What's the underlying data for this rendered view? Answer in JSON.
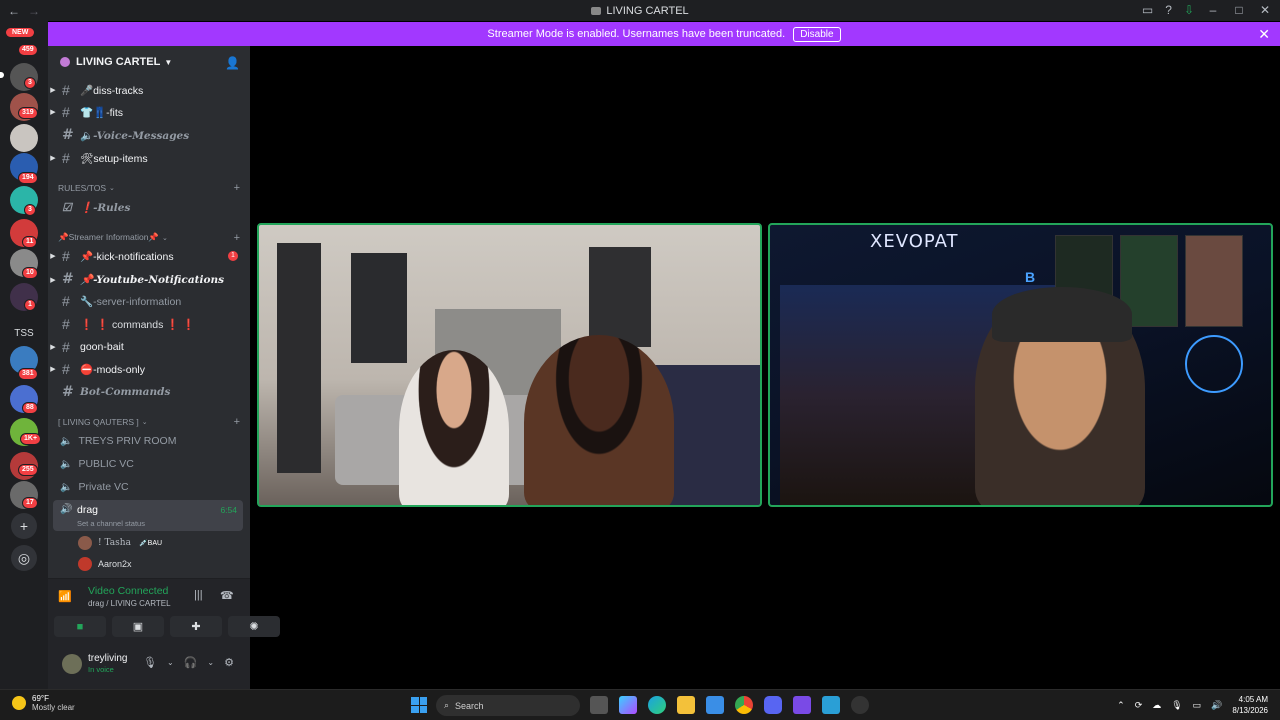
{
  "window": {
    "title": "LIVING CARTEL",
    "back": "←",
    "forward": "→"
  },
  "banner": {
    "text": "Streamer Mode is enabled. Usernames have been truncated.",
    "disable_label": "Disable",
    "close": "✕"
  },
  "rail": {
    "new_label": "NEW",
    "badges": [
      "459",
      "3",
      "319",
      "194",
      "3",
      "11",
      "10",
      "1",
      "381",
      "88",
      "1K+",
      "255",
      "17"
    ],
    "tss_label": "TSS"
  },
  "server": {
    "name": "LIVING CARTEL"
  },
  "channels": [
    {
      "caret": true,
      "name": "🎤diss-tracks",
      "style": "normal"
    },
    {
      "caret": true,
      "name": "👕👖-fits",
      "style": "normal"
    },
    {
      "caret": false,
      "name": "🔈-Voice-Messages",
      "style": "italic-muted"
    },
    {
      "caret": true,
      "name": "🛠setup-items",
      "style": "normal"
    }
  ],
  "categories": {
    "rules": "RULES/TOS",
    "streamer": "📌Streamer Information📌",
    "living": "[ LIVING QAUTERS ]"
  },
  "rules_channel": "❗-Rules",
  "streamer_channels": [
    {
      "caret": true,
      "name": "📌-kick-notifications",
      "style": "normal",
      "mention": "1"
    },
    {
      "caret": true,
      "name": "📌-Youtube-Notifications",
      "style": "italic"
    },
    {
      "caret": false,
      "name": "🔧-server-information",
      "style": "muted"
    },
    {
      "caret": false,
      "name": "❗ ❗ commands ❗ ❗",
      "style": "muted"
    },
    {
      "caret": true,
      "name": "goon-bait",
      "style": "normal"
    },
    {
      "caret": true,
      "name": "⛔-mods-only",
      "style": "normal"
    },
    {
      "caret": false,
      "name": "Bot-Commands",
      "style": "italic-muted"
    }
  ],
  "voice_channels": [
    "TREYS PRIV ROOM",
    "PUBLIC VC",
    "Private VC"
  ],
  "active_vc": {
    "name": "drag",
    "time": "6:54",
    "status": "Set a channel status"
  },
  "members": [
    {
      "name": "! Tasha",
      "tag": "💉BAU"
    },
    {
      "name": "Aaron2x",
      "tag": ""
    }
  ],
  "voice_panel": {
    "title": "Video Connected",
    "subtitle": "drag / LIVING CARTEL"
  },
  "user": {
    "name": "treyliving",
    "status": "In voice"
  },
  "tiles": {
    "neon_text": "XEVOPAT"
  },
  "taskbar": {
    "temp": "69°F",
    "condition": "Mostly clear",
    "search": "Search",
    "time": "4:05 AM",
    "date": "8/13/2026"
  }
}
